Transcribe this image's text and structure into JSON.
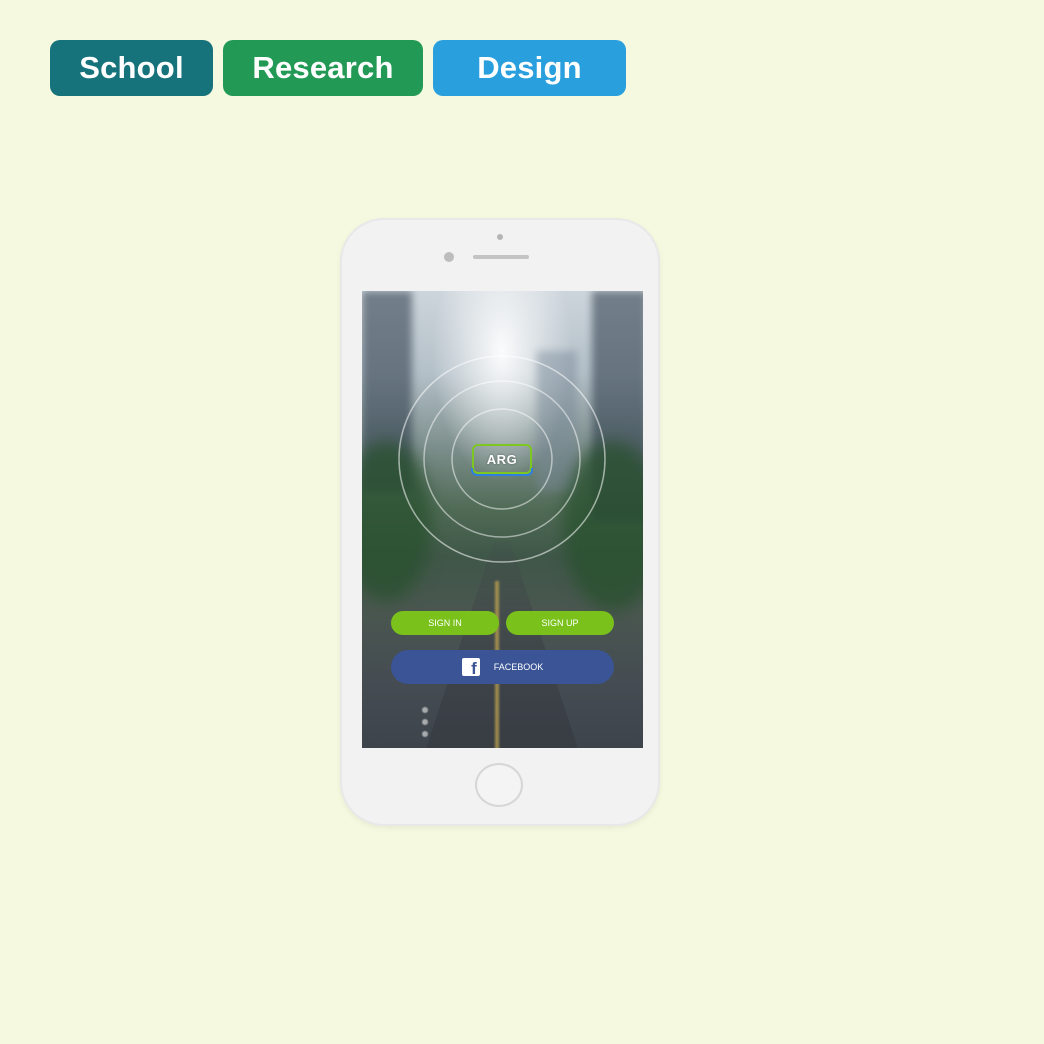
{
  "tags": {
    "school": "School",
    "research": "Research",
    "design": "Design"
  },
  "app": {
    "logo_text": "ARG",
    "sign_in_label": "SIGN IN",
    "sign_up_label": "SIGN UP",
    "facebook_label": "FACEBOOK"
  },
  "colors": {
    "background": "#f5f9df",
    "tag_school": "#17737b",
    "tag_research": "#229a55",
    "tag_design": "#2a9fdd",
    "button_green": "#7ac21b",
    "facebook_blue": "#3a5495"
  },
  "icons": {
    "facebook": "facebook-icon"
  }
}
